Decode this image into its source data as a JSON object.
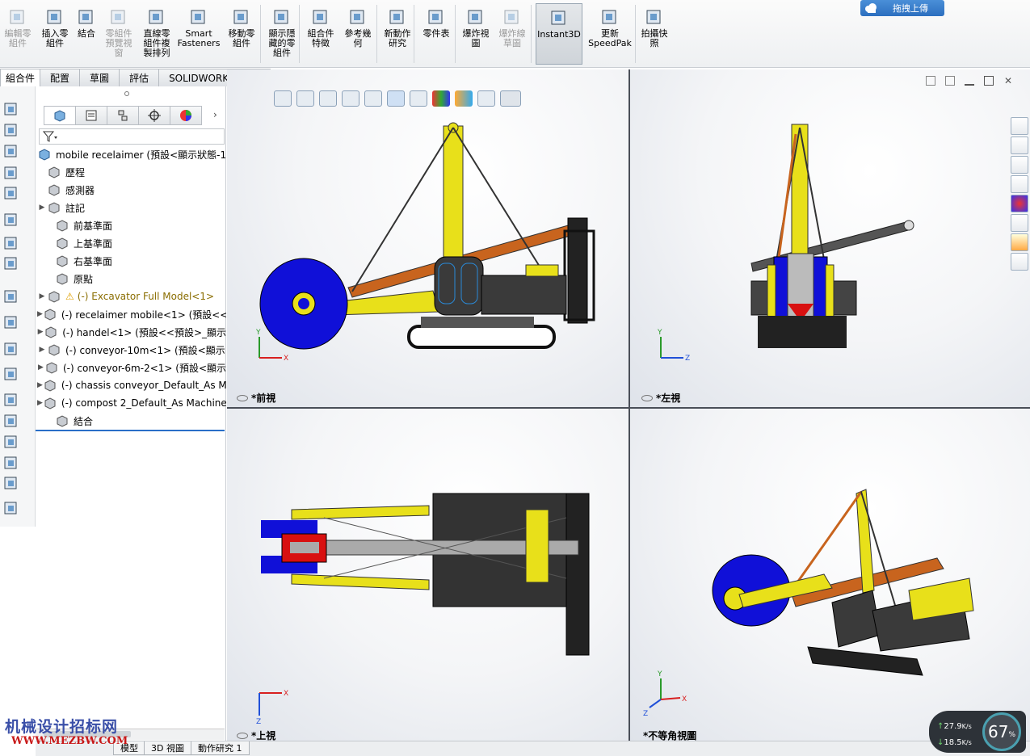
{
  "ribbon": {
    "buttons": [
      {
        "label": "編輯零\n組件",
        "icon": "edit-component-icon",
        "disabled": true
      },
      {
        "label": "插入零\n組件",
        "icon": "insert-component-icon",
        "disabled": false
      },
      {
        "label": "結合",
        "icon": "mate-icon",
        "disabled": false
      },
      {
        "label": "零組件\n預覽視\n窗",
        "icon": "component-preview-icon",
        "disabled": true
      },
      {
        "label": "直線零\n組件複\n製排列",
        "icon": "linear-pattern-icon",
        "disabled": false
      },
      {
        "label": "Smart\nFasteners",
        "icon": "smart-fasteners-icon",
        "disabled": false
      },
      {
        "label": "移動零\n組件",
        "icon": "move-component-icon",
        "disabled": false
      },
      {
        "label": "顯示隱\n藏的零\n組件",
        "icon": "show-hidden-icon",
        "disabled": false
      },
      {
        "label": "組合件\n特徵",
        "icon": "assembly-features-icon",
        "disabled": false
      },
      {
        "label": "參考幾\n何",
        "icon": "reference-geometry-icon",
        "disabled": false
      },
      {
        "label": "新動作\n研究",
        "icon": "new-motion-study-icon",
        "disabled": false
      },
      {
        "label": "零件表",
        "icon": "bom-icon",
        "disabled": false
      },
      {
        "label": "爆炸視\n圖",
        "icon": "exploded-view-icon",
        "disabled": false
      },
      {
        "label": "爆炸線\n草圖",
        "icon": "explode-line-sketch-icon",
        "disabled": true
      },
      {
        "label": "Instant3D",
        "icon": "instant3d-icon",
        "disabled": false
      },
      {
        "label": "更新\nSpeedPak",
        "icon": "speedpak-icon",
        "disabled": false
      },
      {
        "label": "拍攝快\n照",
        "icon": "snapshot-icon",
        "disabled": false
      }
    ]
  },
  "upload_button": {
    "label": "拖拽上傳"
  },
  "tabs": [
    "組合件",
    "配置",
    "草圖",
    "評估",
    "SOLIDWORKS MBD"
  ],
  "tree": {
    "root": "mobile recelaimer  (預設<顯示狀態-1>",
    "items": [
      {
        "label": "歷程",
        "expand": false
      },
      {
        "label": "感測器",
        "expand": false
      },
      {
        "label": "註記",
        "expand": true
      },
      {
        "label": "前基準面",
        "expand": false
      },
      {
        "label": "上基準面",
        "expand": false
      },
      {
        "label": "右基準面",
        "expand": false
      },
      {
        "label": "原點",
        "expand": false
      },
      {
        "label": "(-) Excavator Full Model<1>",
        "expand": true,
        "warning": true
      },
      {
        "label": "(-) recelaimer mobile<1> (預設<<",
        "expand": true
      },
      {
        "label": "(-) handel<1> (預設<<預設>_顯示",
        "expand": true
      },
      {
        "label": "(-) conveyor-10m<1> (預設<顯示",
        "expand": true
      },
      {
        "label": "(-) conveyor-6m-2<1> (預設<顯示",
        "expand": true
      },
      {
        "label": "(-) chassis conveyor_Default_As M",
        "expand": true
      },
      {
        "label": "(-) compost 2_Default_As Machine",
        "expand": true
      },
      {
        "label": "結合",
        "expand": false
      }
    ]
  },
  "viewports": [
    {
      "label": "*前視",
      "triad": [
        "Y",
        "X"
      ]
    },
    {
      "label": "*左視",
      "triad": [
        "Y",
        "Z"
      ]
    },
    {
      "label": "*上視",
      "triad": [
        "X",
        "Z"
      ]
    },
    {
      "label": "*不等角視圖",
      "triad": [
        "Y",
        "X",
        "Z"
      ]
    }
  ],
  "bottom_tabs": [
    "模型",
    "3D 視圖",
    "動作研究 1"
  ],
  "watermark": {
    "line1": "机械设计招标网",
    "line2": "WWW.MEZBW.COM"
  },
  "speed": {
    "up": "27.9",
    "down": "18.5",
    "unit": "K/s",
    "percent": "67",
    "percent_sign": "%"
  },
  "colors": {
    "yellow": "#e8e01a",
    "blue": "#1010d8",
    "dark": "#3a3a3a",
    "orange": "#c8641e",
    "red": "#d81010"
  }
}
